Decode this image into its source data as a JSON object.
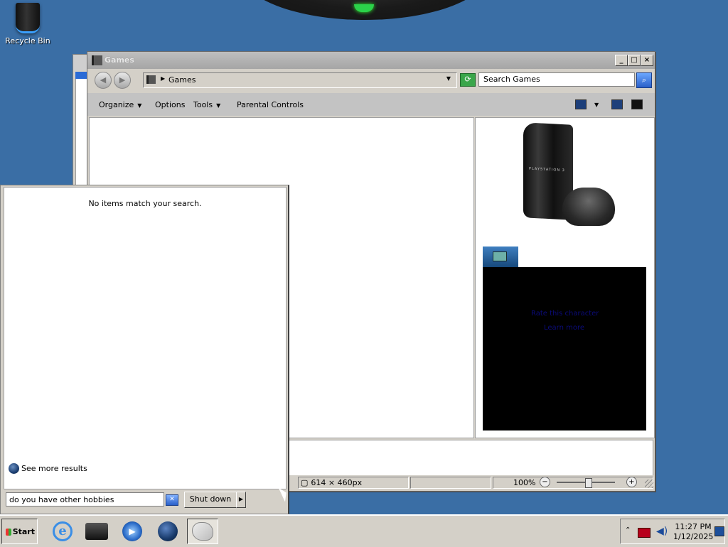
{
  "desktop": {
    "recycle_bin_label": "Recycle Bin"
  },
  "window": {
    "title": "Games",
    "address_path": "Games",
    "search_placeholder": "Search Games",
    "toolbar": {
      "organize": "Organize",
      "options": "Options",
      "tools": "Tools",
      "parental_controls": "Parental Controls"
    },
    "preview": {
      "console_logo": "PLAYSTATION 3",
      "panel_line1": "Rate this character",
      "panel_line2": "Learn more"
    },
    "status": {
      "dimensions": "614 × 460px",
      "zoom": "100%"
    }
  },
  "start_menu": {
    "no_items": "No items match your search.",
    "see_more": "See more results",
    "search_value": "do you have other hobbies",
    "shutdown": "Shut down"
  },
  "taskbar": {
    "start_label": "Start",
    "apps": [
      {
        "name": "internet-explorer",
        "icon": "ie-icon"
      },
      {
        "name": "ps3-game",
        "icon": "ps3-icon"
      },
      {
        "name": "media-player",
        "icon": "media-player-icon"
      },
      {
        "name": "globe",
        "icon": "globe-icon"
      },
      {
        "name": "paint",
        "icon": "paint-icon",
        "active": true
      }
    ],
    "clock_time": "11:27 PM",
    "clock_date": "1/12/2025"
  },
  "colors": {
    "desktop": "#3a6ea5",
    "accent_green": "#2bd24a"
  }
}
